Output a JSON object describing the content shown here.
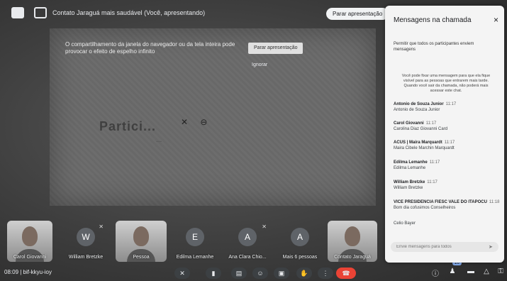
{
  "topbar": {
    "title": "Contato Jaraguá mais saudável (Você, apresentando)",
    "stop_button": "Parar apresentação"
  },
  "share": {
    "warning_text": "O compartilhamento da janela do navegador ou da tela inteira pode provocar o efeito de espelho infinito",
    "stop_button": "Parar apresentação",
    "ignore_button": "Ignorar",
    "ghost_line1": "Partici...",
    "ghost_line2": "..."
  },
  "participants": [
    {
      "name": "Carol Giovanni",
      "type": "video"
    },
    {
      "name": "William Bretzke",
      "type": "avatar",
      "initial": "W"
    },
    {
      "name": "Pessoa",
      "type": "video"
    },
    {
      "name": "Edilma Lemanhe",
      "type": "avatar",
      "initial": "E"
    },
    {
      "name": "Ana Clara Chio...",
      "type": "avatar",
      "initial": "A"
    },
    {
      "name": "Mais 6 pessoas",
      "type": "avatar",
      "initial": "A"
    },
    {
      "name": "Contato Jaraguá",
      "type": "video"
    }
  ],
  "bottombar": {
    "time_code": "08:09 | bif-kkyu-ioy",
    "participants_badge": "16"
  },
  "chat": {
    "title": "Mensagens na chamada",
    "close_icon": "×",
    "toggle_text": "Permitir que todos os participantes enviem mensagens",
    "notice": "Você pode fixar uma mensagem para que ela fique visível para as pessoas que entrarem mais tarde. Quando você sair da chamada, não poderá mais acessar este chat.",
    "messages": [
      {
        "sender": "Antonio de Souza Junior",
        "time": "11:17",
        "text": "Antonio de Souza Junior"
      },
      {
        "sender": "Carol Giovanni",
        "time": "11:17",
        "text": "Carolina Diaz Giovanni Card"
      },
      {
        "sender": "ACUS | Maira Marquardt",
        "time": "11:17",
        "text": "Maira Cibele Marchin Marquardt"
      },
      {
        "sender": "Edilma Lemanhe",
        "time": "11:17",
        "text": "Edilma Lemanhe"
      },
      {
        "sender": "William Bretzke",
        "time": "11:17",
        "text": "William Bretzke"
      },
      {
        "sender": "VICE PRESIDENCIA FIESC VALE DO ITAPOCU",
        "time": "11:18",
        "text": "Bom dia cofusimos Conselheiros"
      },
      {
        "sender": "",
        "time": "",
        "text": "Celio Bayer"
      }
    ],
    "input_placeholder": "Envie mensagens para todos"
  }
}
